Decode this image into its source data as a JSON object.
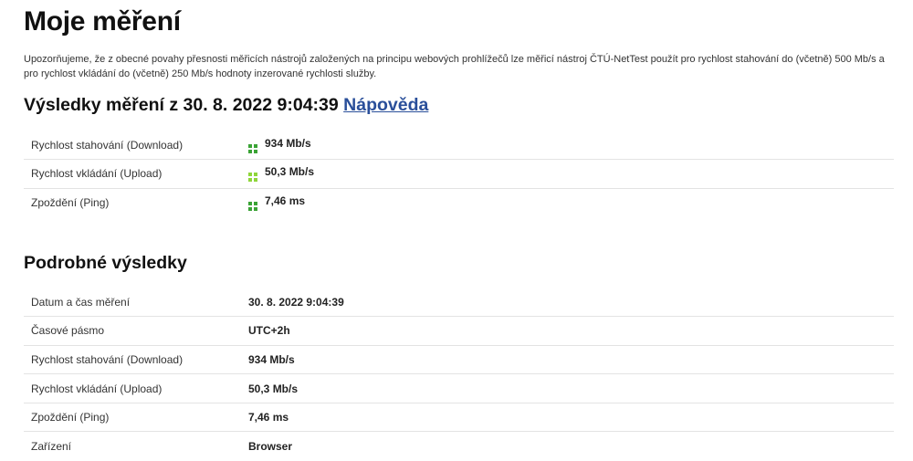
{
  "page": {
    "title": "Moje měření",
    "notice": "Upozorňujeme, že z obecné povahy přesnosti měřicích nástrojů založených na principu webových prohlížečů lze měřicí nástroj ČTÚ-NetTest použít pro rychlost stahování do (včetně) 500 Mb/s a pro rychlost vkládání do (včetně) 250 Mb/s hodnoty inzerované rychlosti služby."
  },
  "results": {
    "heading_prefix": "Výsledky měření z 30. 8. 2022 9:04:39",
    "help_link": "Nápověda",
    "rows": [
      {
        "label": "Rychlost stahování (Download)",
        "value": "934 Mb/s",
        "quality_color": "#3aa335"
      },
      {
        "label": "Rychlost vkládání (Upload)",
        "value": "50,3 Mb/s",
        "quality_color": "#8fd63a"
      },
      {
        "label": "Zpoždění (Ping)",
        "value": "7,46 ms",
        "quality_color": "#3aa335"
      }
    ]
  },
  "details": {
    "heading": "Podrobné výsledky",
    "rows": [
      {
        "label": "Datum a čas měření",
        "value": "30. 8. 2022 9:04:39"
      },
      {
        "label": "Časové pásmo",
        "value": "UTC+2h"
      },
      {
        "label": "Rychlost stahování (Download)",
        "value": "934 Mb/s"
      },
      {
        "label": "Rychlost vkládání (Upload)",
        "value": "50,3 Mb/s"
      },
      {
        "label": "Zpoždění (Ping)",
        "value": "7,46 ms"
      },
      {
        "label": "Zařízení",
        "value": "Browser"
      }
    ]
  }
}
